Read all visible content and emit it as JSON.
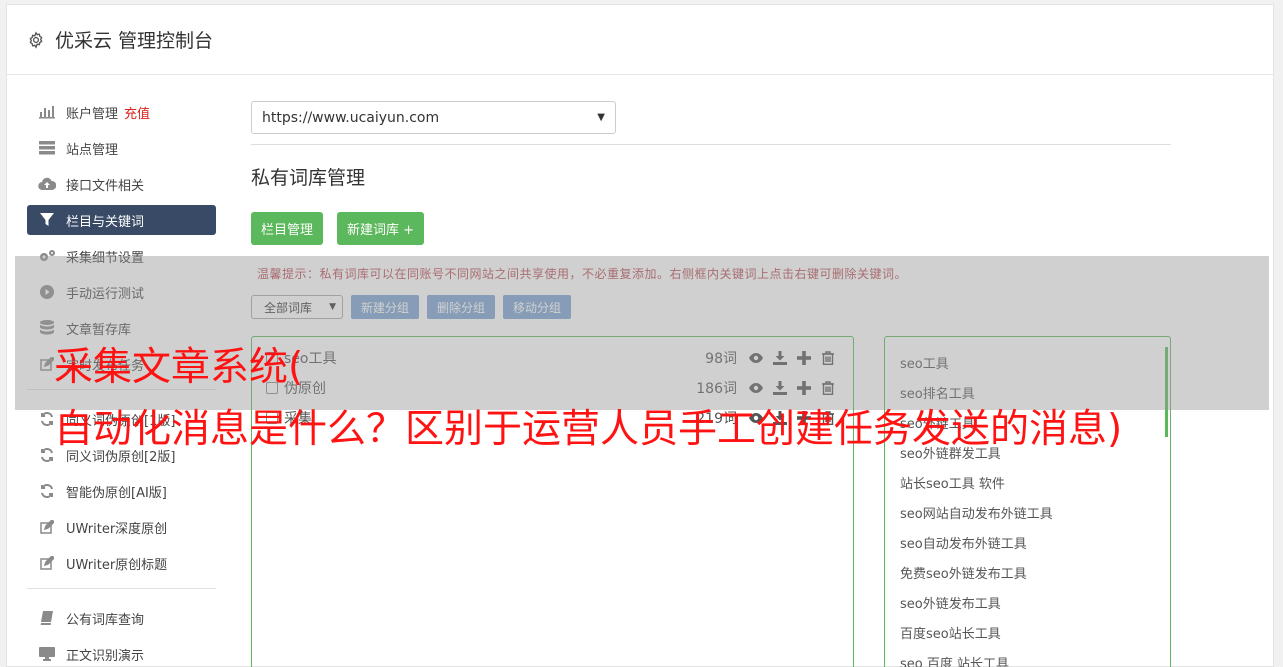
{
  "header": {
    "title": "优采云 管理控制台"
  },
  "sidebar": {
    "items": [
      {
        "label": "账户管理",
        "badge": "充值"
      },
      {
        "label": "站点管理"
      },
      {
        "label": "接口文件相关"
      },
      {
        "label": "栏目与关键词"
      },
      {
        "label": "采集细节设置"
      },
      {
        "label": "手动运行测试"
      },
      {
        "label": "文章暂存库"
      },
      {
        "label": "定时发布任务"
      }
    ],
    "items2": [
      {
        "label": "同义词伪原创[1版]"
      },
      {
        "label": "同义词伪原创[2版]"
      },
      {
        "label": "智能伪原创[AI版]"
      },
      {
        "label": "UWriter深度原创"
      },
      {
        "label": "UWriter原创标题"
      }
    ],
    "items3": [
      {
        "label": "公有词库查询"
      },
      {
        "label": "正文识别演示"
      }
    ]
  },
  "main": {
    "site_select_value": "https://www.ucaiyun.com",
    "section_title": "私有词库管理",
    "btn_columns": "栏目管理",
    "btn_new_lib": "新建词库 +",
    "tip": "温馨提示：私有词库可以在同账号不同网站之间共享使用，不必重复添加。右侧框内关键词上点击右键可删除关键词。",
    "lib_select_value": "全部词库",
    "btn_new_group": "新建分组",
    "btn_delete_group": "删除分组",
    "btn_move_group": "移动分组"
  },
  "libraries": [
    {
      "name": "seo工具",
      "count": "98词"
    },
    {
      "name": "伪原创",
      "count": "186词"
    },
    {
      "name": "采集",
      "count": "219词"
    }
  ],
  "keywords": [
    "seo工具",
    "seo排名工具",
    "seo外链工具",
    "seo外链群发工具",
    "站长seo工具 软件",
    "seo网站自动发布外链工具",
    "seo自动发布外链工具",
    "免费seo外链发布工具",
    "seo外链发布工具",
    "百度seo站长工具",
    "seo 百度 站长工具"
  ],
  "overlay": {
    "line1": "采集文章系统(",
    "line2": "自动化消息是什么？区别于运营人员手工创建任务发送的消息)"
  },
  "colors": {
    "accent": "#384a66",
    "green": "#5cb85c",
    "blue": "#7aa3d2",
    "overlay_text": "#ff1212"
  }
}
